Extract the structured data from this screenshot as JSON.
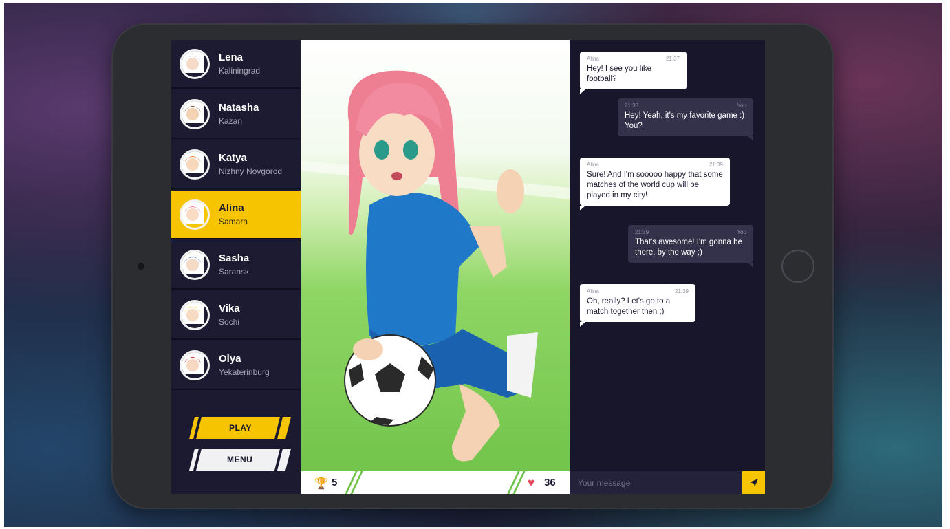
{
  "contacts": [
    {
      "name": "Lena",
      "city": "Kaliningrad",
      "hair": "#d8d8e8",
      "skin": "#f6dcc8",
      "active": false
    },
    {
      "name": "Natasha",
      "city": "Kazan",
      "hair": "#7a4320",
      "skin": "#f4d2b4",
      "active": false
    },
    {
      "name": "Katya",
      "city": "Nizhny Novgorod",
      "hair": "#e87a28",
      "skin": "#f7d8bd",
      "active": false
    },
    {
      "name": "Alina",
      "city": "Samara",
      "hair": "#ee7f93",
      "skin": "#f8dcc4",
      "active": true
    },
    {
      "name": "Sasha",
      "city": "Saransk",
      "hair": "#3a56b4",
      "skin": "#f5dac6",
      "active": false
    },
    {
      "name": "Vika",
      "city": "Sochi",
      "hair": "#f3c84a",
      "skin": "#f7dbc3",
      "active": false
    },
    {
      "name": "Olya",
      "city": "Yekaterinburg",
      "hair": "#c8262c",
      "skin": "#f6d7c1",
      "active": false
    }
  ],
  "buttons": {
    "play": "PLAY",
    "menu": "MENU"
  },
  "stats": {
    "trophies": "5",
    "hearts": "36"
  },
  "chat": {
    "messages": [
      {
        "from": "Alina",
        "time": "21:37",
        "text": "Hey! I see you like football?",
        "dir": "in"
      },
      {
        "from": "You",
        "time": "21:38",
        "text": "Hey! Yeah, it's my favorite game :) You?",
        "dir": "out"
      },
      {
        "from": "Alina",
        "time": "21:39",
        "text": "Sure! And I'm sooooo happy that some matches of the world cup will be played in my city!",
        "dir": "in"
      },
      {
        "from": "You",
        "time": "21:39",
        "text": "That's awesome! I'm gonna be there, by the way ;)",
        "dir": "out"
      },
      {
        "from": "Alina",
        "time": "21:39",
        "text": "Oh, really? Let's go to a match together then ;)",
        "dir": "in"
      }
    ],
    "placeholder": "Your message"
  },
  "icons": {
    "trophy": "trophy-icon",
    "heart": "heart-icon",
    "send": "send-icon"
  },
  "colors": {
    "accent": "#f6c400",
    "panel": "#1b1a30"
  }
}
